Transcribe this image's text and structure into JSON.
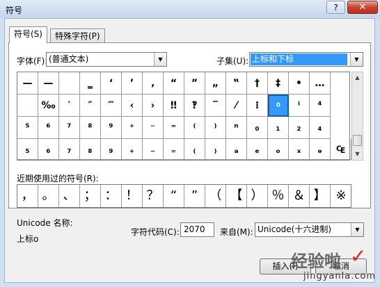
{
  "window": {
    "title": "符号",
    "help": "?",
    "close": "✕"
  },
  "tabs": [
    {
      "label": "符号(S)"
    },
    {
      "label": "特殊字符(P)"
    }
  ],
  "font": {
    "label": "字体(F):",
    "value": "(普通文本)"
  },
  "subset": {
    "label": "子集(U):",
    "value": "上标和下标"
  },
  "grid": {
    "rows": [
      [
        "—",
        "—",
        "",
        "‗",
        "‘",
        "’",
        "‚",
        "“",
        "”",
        "„",
        "‟",
        "†",
        "‡",
        "•",
        "…"
      ],
      [
        "",
        "‰",
        "′",
        "″",
        "‴",
        "‹",
        "›",
        "‼",
        "‽",
        "‾",
        "⁄",
        "⁝",
        "⁰",
        "ⁱ",
        "⁴"
      ],
      [
        "⁵",
        "⁶",
        "⁷",
        "⁸",
        "⁹",
        "⁺",
        "⁻",
        "⁼",
        "⁽",
        "⁾",
        "ⁿ",
        "₀",
        "₁",
        "₂",
        "₄"
      ],
      [
        "₅",
        "₆",
        "₇",
        "₈",
        "₉",
        "₊",
        "₋",
        "₌",
        "₍",
        "₎",
        "ₐ",
        "ₑ",
        "ₒ",
        "ₓ",
        "ₔ",
        "₠"
      ]
    ]
  },
  "recent": {
    "label": "近期使用过的符号(R):",
    "symbols": [
      "，",
      "。",
      "、",
      "；",
      "：",
      "！",
      "？",
      "“",
      "”",
      "（",
      "【",
      "）",
      "％",
      "＆",
      "】",
      "※"
    ]
  },
  "unicode_name": {
    "label": "Unicode 名称:",
    "value": "上标o"
  },
  "char_code": {
    "label": "字符代码(C):",
    "value": "2070"
  },
  "from": {
    "label": "来自(M):",
    "value": "Unicode(十六进制)"
  },
  "buttons": {
    "insert": "插入(I)",
    "cancel": "取消"
  },
  "watermark": {
    "text": "经验啦",
    "sub": "jingyanla.com"
  }
}
